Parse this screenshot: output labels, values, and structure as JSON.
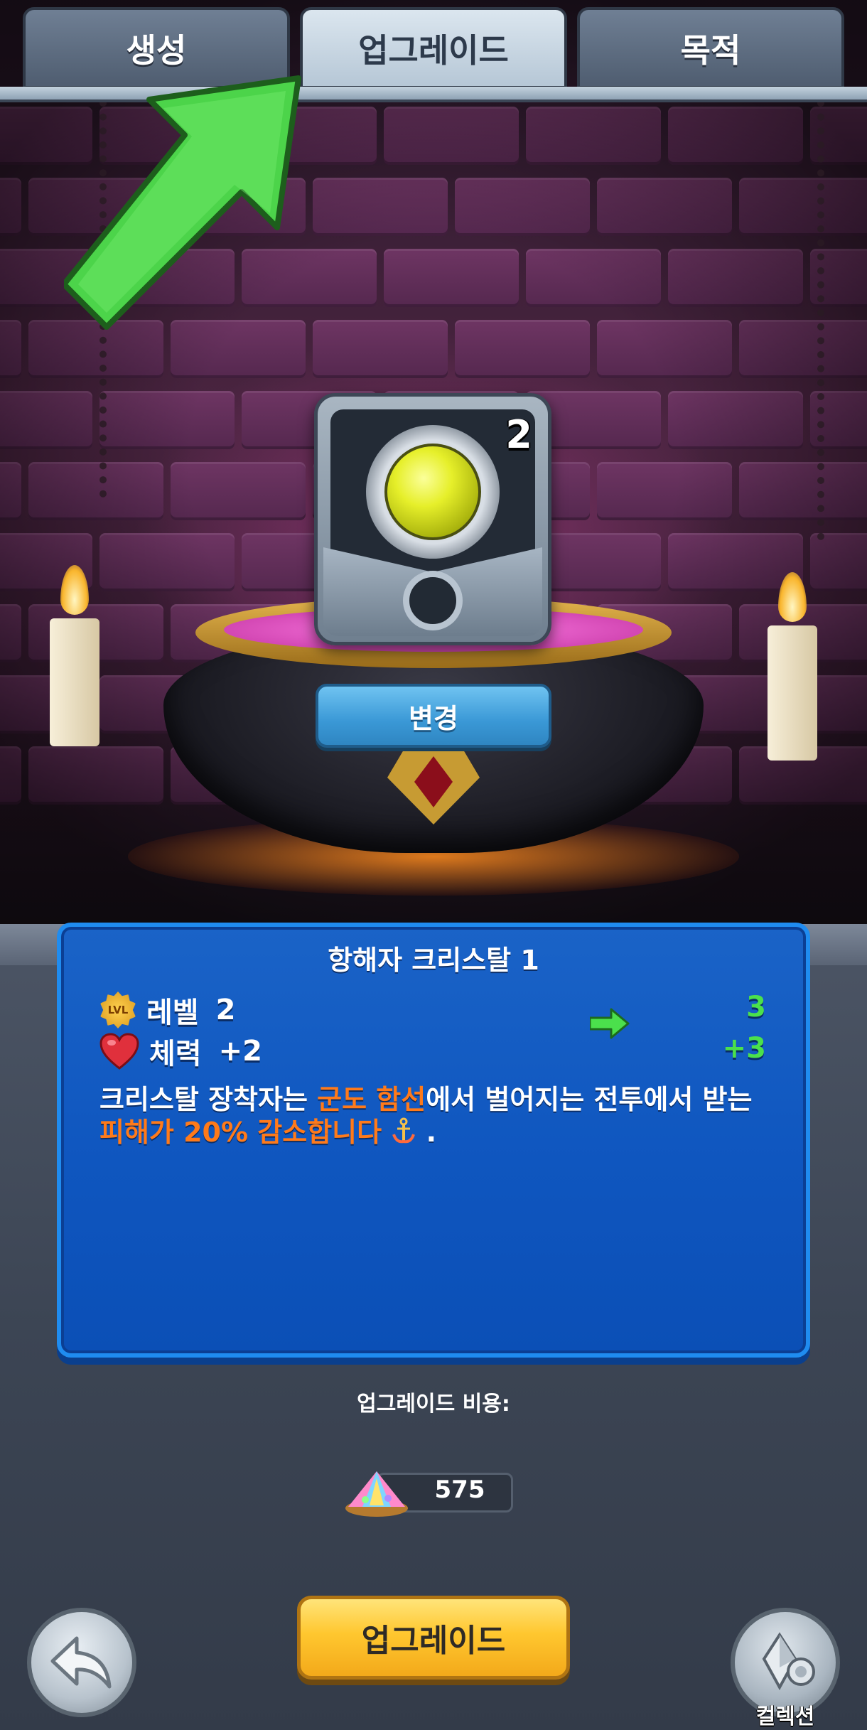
{
  "tabs": [
    {
      "label": "생성",
      "active": false
    },
    {
      "label": "업그레이드",
      "active": true
    },
    {
      "label": "목적",
      "active": false
    }
  ],
  "crystal": {
    "count": "2",
    "gem_color": "#e6ef2a",
    "icon": "yellow-crystal-icon"
  },
  "change_button": {
    "label": "변경"
  },
  "info": {
    "title": "항해자 크리스탈 1",
    "level": {
      "icon": "lvl-badge-icon",
      "icon_text": "LVL",
      "label": "레벨",
      "current": "2",
      "next": "3"
    },
    "health": {
      "icon": "heart-icon",
      "label": "체력",
      "current": "+2",
      "next": "+3"
    },
    "description": {
      "p1": "크리스탈 장착자는 ",
      "h1": "군도 함선",
      "p2": "에서 벌어지는 전투에서 받는 ",
      "h2": "피해가 20% 감소합니다",
      "p3": " ."
    },
    "highlight_color": "#ff7a1a",
    "upgrade_color": "#4be04c"
  },
  "cost": {
    "label": "업그레이드 비용:",
    "icon": "crystal-dust-icon",
    "value": "575"
  },
  "upgrade_button": {
    "label": "업그레이드"
  },
  "back_button": {
    "icon": "back-arrow-icon"
  },
  "collection_button": {
    "icon": "gem-collection-icon",
    "label": "컬렉션"
  },
  "colors": {
    "panel_blue": "#0f56bf",
    "button_yellow": "#ffc72f",
    "tab_active": "#dbe6ef",
    "pointer_arrow": "#4cd44a"
  }
}
